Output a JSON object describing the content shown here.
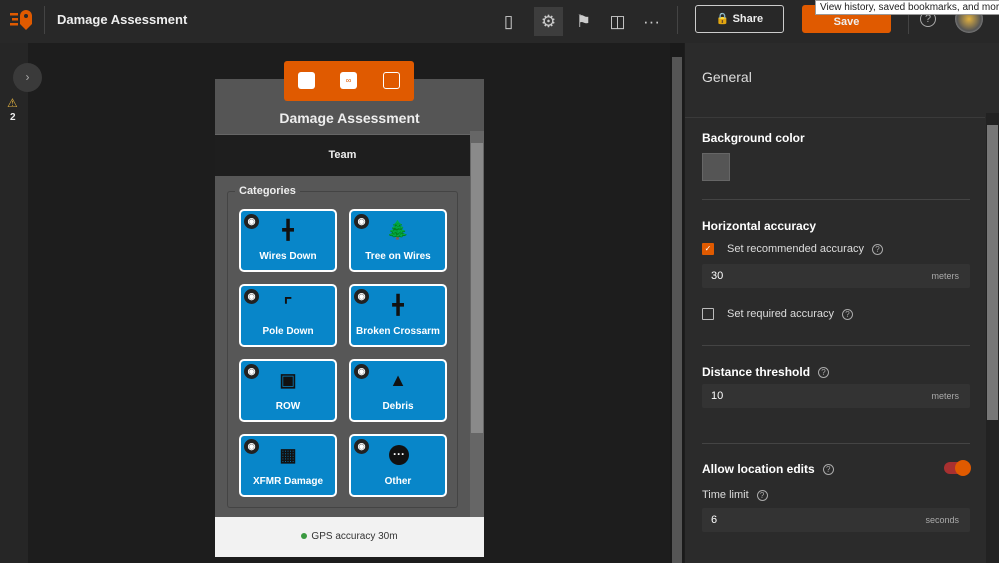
{
  "app": {
    "title": "Damage Assessment",
    "tooltip": "View history, saved bookmarks, and more",
    "share_label": "Share",
    "save_label": "Save",
    "warnings_count": "2",
    "accent": "#e05a00"
  },
  "toolbar_icons": [
    "phone-icon",
    "gear-icon",
    "map-icon",
    "layout-icon",
    "more-icon"
  ],
  "preview": {
    "title": "Damage Assessment",
    "team": "Team",
    "group_label": "Categories",
    "tiles": [
      {
        "label": "Wires Down"
      },
      {
        "label": "Tree on Wires"
      },
      {
        "label": "Pole Down"
      },
      {
        "label": "Broken Crossarm"
      },
      {
        "label": "ROW"
      },
      {
        "label": "Debris"
      },
      {
        "label": "XFMR Damage"
      },
      {
        "label": "Other"
      }
    ],
    "tile_color": "#0886c9",
    "footer": "GPS accuracy 30m"
  },
  "panel": {
    "title": "General",
    "background_color_label": "Background color",
    "background_color": "#555555",
    "horizontal_accuracy": "Horizontal accuracy",
    "recommended_label": "Set recommended accuracy",
    "recommended_checked": true,
    "recommended_value": "30",
    "recommended_unit": "meters",
    "required_label": "Set required accuracy",
    "required_checked": false,
    "distance_label": "Distance threshold",
    "distance_value": "10",
    "distance_unit": "meters",
    "location_edits_label": "Allow location edits",
    "location_edits_on": true,
    "time_limit_label": "Time limit",
    "time_limit_value": "6",
    "time_limit_unit": "seconds"
  }
}
